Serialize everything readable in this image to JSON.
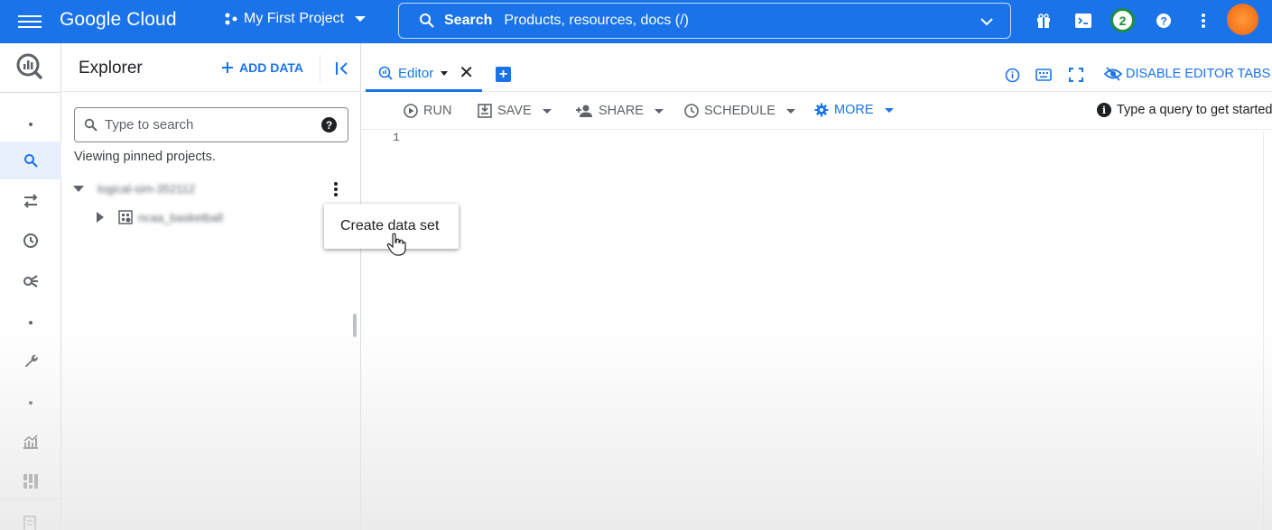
{
  "topbar": {
    "brand": "Google Cloud",
    "project": "My First Project",
    "search_label": "Search",
    "search_placeholder": "Products, resources, docs (/)",
    "notifications_count": "2",
    "colors": {
      "bar": "#1a73e8",
      "badge": "#1e8e3e",
      "avatar": "#f0620a"
    }
  },
  "rail": {
    "items": [
      "bigquery-logo",
      "search-icon",
      "transfers-icon",
      "history-icon",
      "dataflow-icon",
      "wrench-icon",
      "analytics-icon",
      "dashboard-icon",
      "document-icon"
    ]
  },
  "explorer": {
    "title": "Explorer",
    "add_data": "ADD DATA",
    "search_placeholder": "Type to search",
    "pinned_note": "Viewing pinned projects.",
    "project_name": "logical-sim-352112",
    "dataset_name": "ncaa_basketball"
  },
  "context_menu": {
    "items": [
      "Create data set"
    ]
  },
  "editor": {
    "tab_label": "Editor",
    "disable_tabs": "DISABLE EDITOR TABS",
    "toolbar": {
      "run": "RUN",
      "save": "SAVE",
      "share": "SHARE",
      "schedule": "SCHEDULE",
      "more": "MORE"
    },
    "hint": "Type a query to get started",
    "line_numbers": [
      "1"
    ]
  }
}
